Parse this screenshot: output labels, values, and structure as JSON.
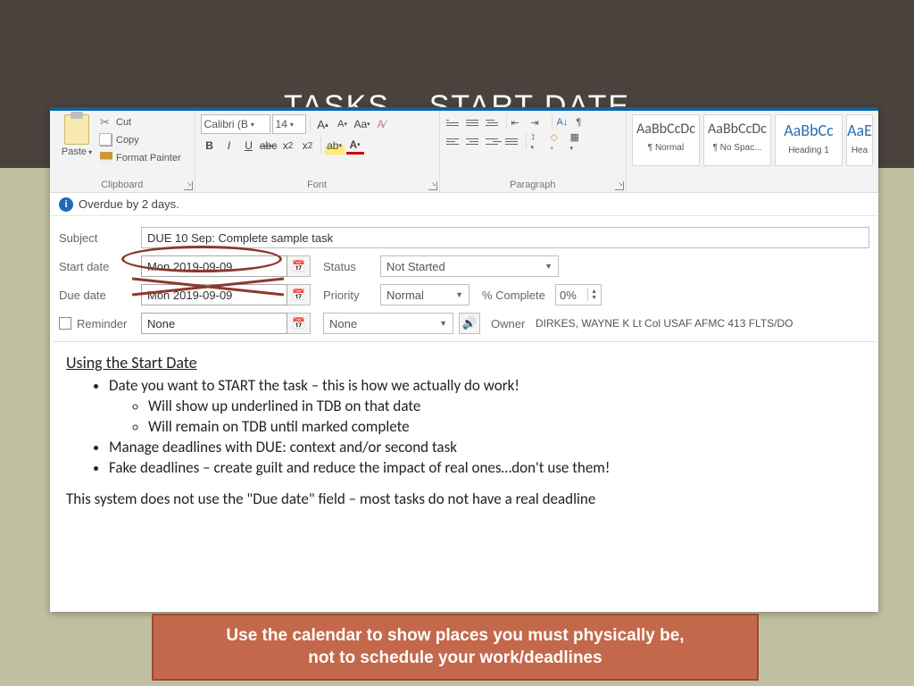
{
  "slide": {
    "title": "TASKS – START DATE"
  },
  "ribbon": {
    "paste_label": "Paste",
    "cut_label": "Cut",
    "copy_label": "Copy",
    "fmtpainter_label": "Format Painter",
    "clipboard_group": "Clipboard",
    "font_name": "Calibri (B",
    "font_size": "14",
    "font_group": "Font",
    "para_group": "Paragraph",
    "styles": {
      "normal_sample": "AaBbCcDc",
      "normal_name": "¶ Normal",
      "nospace_sample": "AaBbCcDc",
      "nospace_name": "¶ No Spac...",
      "heading1_sample": "AaBbCc",
      "heading1_name": "Heading 1",
      "heading2_sample": "AaE",
      "heading2_name": "Hea"
    }
  },
  "info": {
    "text": "Overdue by 2 days."
  },
  "form": {
    "subject_label": "Subject",
    "subject_value": "DUE 10 Sep: Complete sample task",
    "startdate_label": "Start date",
    "startdate_value": "Mon 2019-09-09",
    "duedate_label": "Due date",
    "duedate_value": "Mon 2019-09-09",
    "status_label": "Status",
    "status_value": "Not Started",
    "priority_label": "Priority",
    "priority_value": "Normal",
    "pct_label": "% Complete",
    "pct_value": "0%",
    "reminder_label": "Reminder",
    "reminder_date": "None",
    "reminder_time": "None",
    "owner_label": "Owner",
    "owner_value": "DIRKES, WAYNE K Lt Col USAF AFMC 413 FLTS/DO"
  },
  "content": {
    "heading": "Using the Start Date",
    "b1": "Date you want to START the task – this is how we actually do work!",
    "b1a": "Will show up underlined in TDB on that date",
    "b1b": "Will remain on TDB until marked complete",
    "b2": "Manage deadlines with DUE: context and/or second task",
    "b3": "Fake deadlines – create guilt and reduce the impact of real ones…don't use them!",
    "p1": "This system does not use the \"Due date\" field – most tasks do not have a real deadline"
  },
  "callout": {
    "line1": "Use the calendar to show places you must physically be,",
    "line2": "not to schedule your work/deadlines"
  }
}
